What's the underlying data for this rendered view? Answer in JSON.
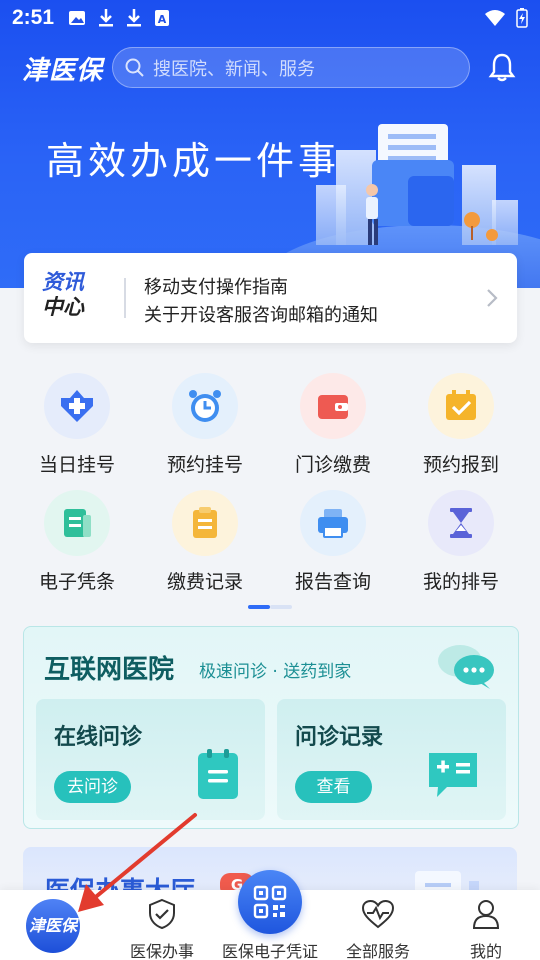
{
  "status_bar": {
    "time": "2:51",
    "icons": [
      "image-icon",
      "download-icon",
      "download-icon",
      "text-icon"
    ],
    "right_icons": [
      "wifi-icon",
      "battery-charging-icon"
    ]
  },
  "header": {
    "logo": "津医保",
    "search_placeholder": "搜医院、新闻、服务"
  },
  "banner": {
    "slogan": "高效办成一件事"
  },
  "news": {
    "logo_line1": "资讯",
    "logo_line2": "中心",
    "items": [
      "移动支付操作指南",
      "关于开设客服咨询邮箱的通知"
    ]
  },
  "services": [
    {
      "label": "当日挂号",
      "icon": "medical-cross-icon",
      "color": "#3a6ff0",
      "bg": "#e5ecfb"
    },
    {
      "label": "预约挂号",
      "icon": "alarm-clock-icon",
      "color": "#3f8ef0",
      "bg": "#e4f0fc"
    },
    {
      "label": "门诊缴费",
      "icon": "wallet-icon",
      "color": "#ee5a52",
      "bg": "#fde9e8"
    },
    {
      "label": "预约报到",
      "icon": "calendar-check-icon",
      "color": "#f5b42a",
      "bg": "#fdf3dc"
    },
    {
      "label": "电子凭条",
      "icon": "receipt-icon",
      "color": "#2fbf9a",
      "bg": "#e2f6f0"
    },
    {
      "label": "缴费记录",
      "icon": "clipboard-icon",
      "color": "#f4b63a",
      "bg": "#fdf3dc"
    },
    {
      "label": "报告查询",
      "icon": "printer-icon",
      "color": "#3f8ef0",
      "bg": "#e4f0fc"
    },
    {
      "label": "我的排号",
      "icon": "hourglass-icon",
      "color": "#5a63d8",
      "bg": "#e8e9fa"
    }
  ],
  "internet_hospital": {
    "title": "互联网医院",
    "subtitle": "极速问诊 · 送药到家",
    "cards": [
      {
        "title": "在线问诊",
        "button": "去问诊",
        "icon": "clipboard-list-icon"
      },
      {
        "title": "问诊记录",
        "button": "查看",
        "icon": "chat-equals-icon"
      }
    ]
  },
  "hall": {
    "title": "医保办事大厅",
    "badge": "G"
  },
  "bottom_nav": {
    "home": "津医保",
    "items": [
      {
        "label": "医保办事",
        "icon": "shield-check-icon"
      },
      {
        "label": "医保电子凭证",
        "icon": "qr-code-icon"
      },
      {
        "label": "全部服务",
        "icon": "heart-pulse-icon"
      },
      {
        "label": "我的",
        "icon": "user-icon"
      }
    ]
  },
  "colors": {
    "primary": "#2f6cf7",
    "teal": "#27c1bc",
    "annotation_arrow": "#e23b2e"
  }
}
